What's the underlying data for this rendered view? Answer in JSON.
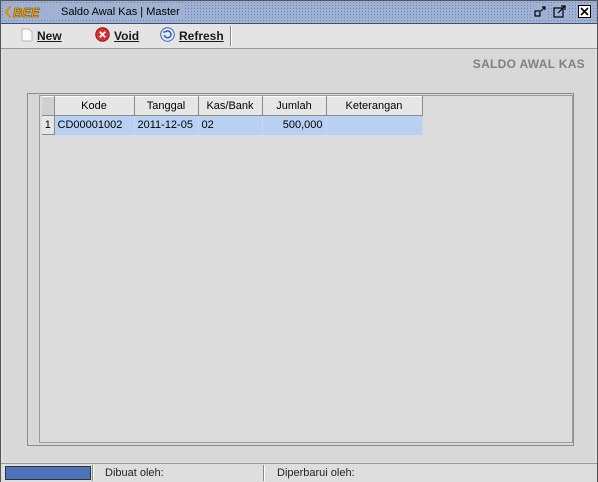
{
  "window": {
    "logo_text": "BEE",
    "title": "Saldo Awal Kas | Master"
  },
  "toolbar": {
    "new_label": "New",
    "void_label": "Void",
    "refresh_label": "Refresh"
  },
  "section": {
    "title": "SALDO AWAL KAS"
  },
  "table": {
    "columns": [
      "Kode",
      "Tanggal",
      "Kas/Bank",
      "Jumlah",
      "Keterangan"
    ],
    "rows": [
      {
        "num": "1",
        "kode": "CD00001002",
        "tanggal": "2011-12-05",
        "kas_bank": "02",
        "jumlah": "500,000",
        "keterangan": ""
      }
    ]
  },
  "statusbar": {
    "created_by_label": "Dibuat oleh:",
    "updated_by_label": "Diperbarui oleh:"
  },
  "colors": {
    "titlebar": "#9fb2d4",
    "selected_row": "#b8d1f3",
    "progress": "#4f73b8"
  }
}
